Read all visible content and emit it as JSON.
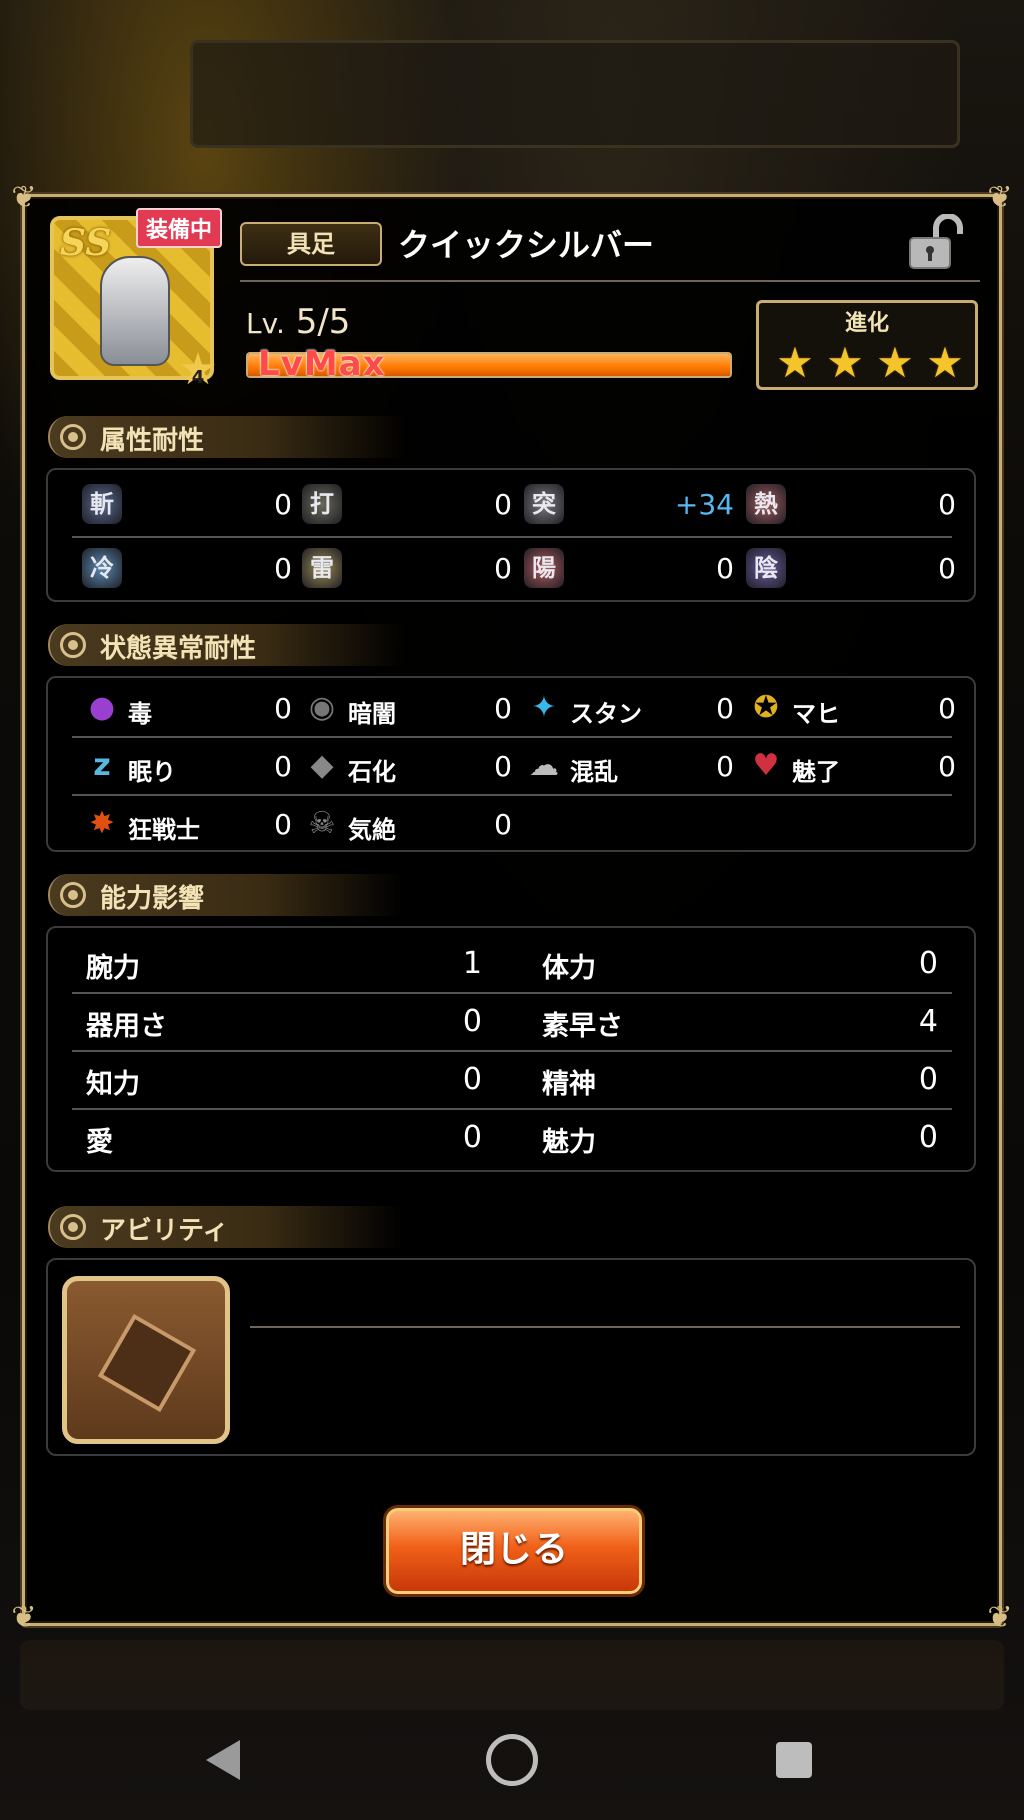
{
  "item": {
    "rarity": "SS",
    "equipped_label": "装備中",
    "star_badge": "4",
    "type": "具足",
    "name": "クイックシルバー",
    "level_prefix": "Lv.",
    "level": "5/5",
    "exp_label": "LvMax",
    "exp_progress": 1.0,
    "evolution_label": "進化",
    "evolution_stars": 4,
    "locked": false
  },
  "sections": {
    "attribute": "属性耐性",
    "status": "状態異常耐性",
    "ability_effect": "能力影響",
    "ability": "アビリティ"
  },
  "attribute_resistance": [
    {
      "icon": "斬",
      "value": "0"
    },
    {
      "icon": "打",
      "value": "0"
    },
    {
      "icon": "突",
      "value": "+34",
      "highlight": true
    },
    {
      "icon": "熱",
      "value": "0"
    },
    {
      "icon": "冷",
      "value": "0"
    },
    {
      "icon": "雷",
      "value": "0"
    },
    {
      "icon": "陽",
      "value": "0"
    },
    {
      "icon": "陰",
      "value": "0"
    }
  ],
  "status_resistance": [
    {
      "label": "毒",
      "icon": "poison-icon",
      "value": "0"
    },
    {
      "label": "暗闇",
      "icon": "eye-icon",
      "value": "0"
    },
    {
      "label": "スタン",
      "icon": "stun-icon",
      "value": "0"
    },
    {
      "label": "マヒ",
      "icon": "paralysis-icon",
      "value": "0"
    },
    {
      "label": "眠り",
      "icon": "sleep-icon",
      "value": "0"
    },
    {
      "label": "石化",
      "icon": "stone-icon",
      "value": "0"
    },
    {
      "label": "混乱",
      "icon": "confusion-icon",
      "value": "0"
    },
    {
      "label": "魅了",
      "icon": "charm-icon",
      "value": "0"
    },
    {
      "label": "狂戦士",
      "icon": "berserk-icon",
      "value": "0"
    },
    {
      "label": "気絶",
      "icon": "faint-icon",
      "value": "0"
    }
  ],
  "stats": [
    {
      "label": "腕力",
      "value": "1"
    },
    {
      "label": "体力",
      "value": "0"
    },
    {
      "label": "器用さ",
      "value": "0"
    },
    {
      "label": "素早さ",
      "value": "4"
    },
    {
      "label": "知力",
      "value": "0"
    },
    {
      "label": "精神",
      "value": "0"
    },
    {
      "label": "愛",
      "value": "0"
    },
    {
      "label": "魅力",
      "value": "0"
    }
  ],
  "close_label": "閉じる",
  "colors": {
    "accent": "#c9ad74",
    "positive": "#58b8f0",
    "button": "#f06018"
  }
}
